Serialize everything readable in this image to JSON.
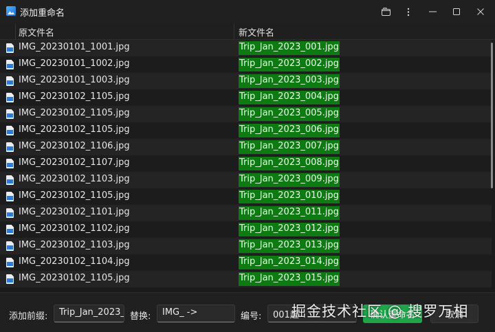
{
  "window": {
    "title": "添加重命名",
    "controls": [
      "folder-icon",
      "more-icon",
      "minimize-icon",
      "maximize-icon",
      "close-icon"
    ]
  },
  "columns": {
    "original": "原文件名",
    "new": "新文件名"
  },
  "rows": [
    {
      "original": "IMG_20230101_1001.jpg",
      "new": "Trip_Jan_2023_001.jpg"
    },
    {
      "original": "IMG_20230101_1002.jpg",
      "new": "Trip_Jan_2023_002.jpg"
    },
    {
      "original": "IMG_20230101_1003.jpg",
      "new": "Trip_Jan_2023_003.jpg"
    },
    {
      "original": "IMG_20230102_1105.jpg",
      "new": "Trip_Jan_2023_004.jpg"
    },
    {
      "original": "IMG_20230102_1105.jpg",
      "new": "Trip_Jan_2023_005.jpg"
    },
    {
      "original": "IMG_20230102_1105.jpg",
      "new": "Trip_Jan_2023_006.jpg"
    },
    {
      "original": "IMG_20230102_1106.jpg",
      "new": "Trip_Jan_2023_007.jpg"
    },
    {
      "original": "IMG_20230102_1107.jpg",
      "new": "Trip_Jan_2023_008.jpg"
    },
    {
      "original": "IMG_20230102_1103.jpg",
      "new": "Trip_Jan_2023_009.jpg"
    },
    {
      "original": "IMG_20230102_1105.jpg",
      "new": "Trip_Jan_2023_010.jpg"
    },
    {
      "original": "IMG_20230102_1101.jpg",
      "new": "Trip_Jan_2023_011.jpg"
    },
    {
      "original": "IMG_20230102_1102.jpg",
      "new": "Trip_Jan_2023_012.jpg"
    },
    {
      "original": "IMG_20230102_1103.jpg",
      "new": "Trip_Jan_2023_013.jpg"
    },
    {
      "original": "IMG_20230102_1104.jpg",
      "new": "Trip_Jan_2023_014.jpg"
    },
    {
      "original": "IMG_20230102_1105.jpg",
      "new": "Trip_Jan_2023_015.jpg"
    }
  ],
  "footer": {
    "prefix_label": "添加前缀:",
    "prefix_value": "Trip_Jan_2023_",
    "replace_label": "替换:",
    "replace_value": "IMG_ ->",
    "number_label": "编号:",
    "number_value": "001起",
    "confirm_label": "确认重命名",
    "cancel_label": "取消"
  },
  "watermark": "掘金技术社区 @ 搜罗万相",
  "colors": {
    "new_name_highlight": "#0e7a12",
    "confirm_button": "#1fa44a",
    "background": "#1b1b1b"
  }
}
